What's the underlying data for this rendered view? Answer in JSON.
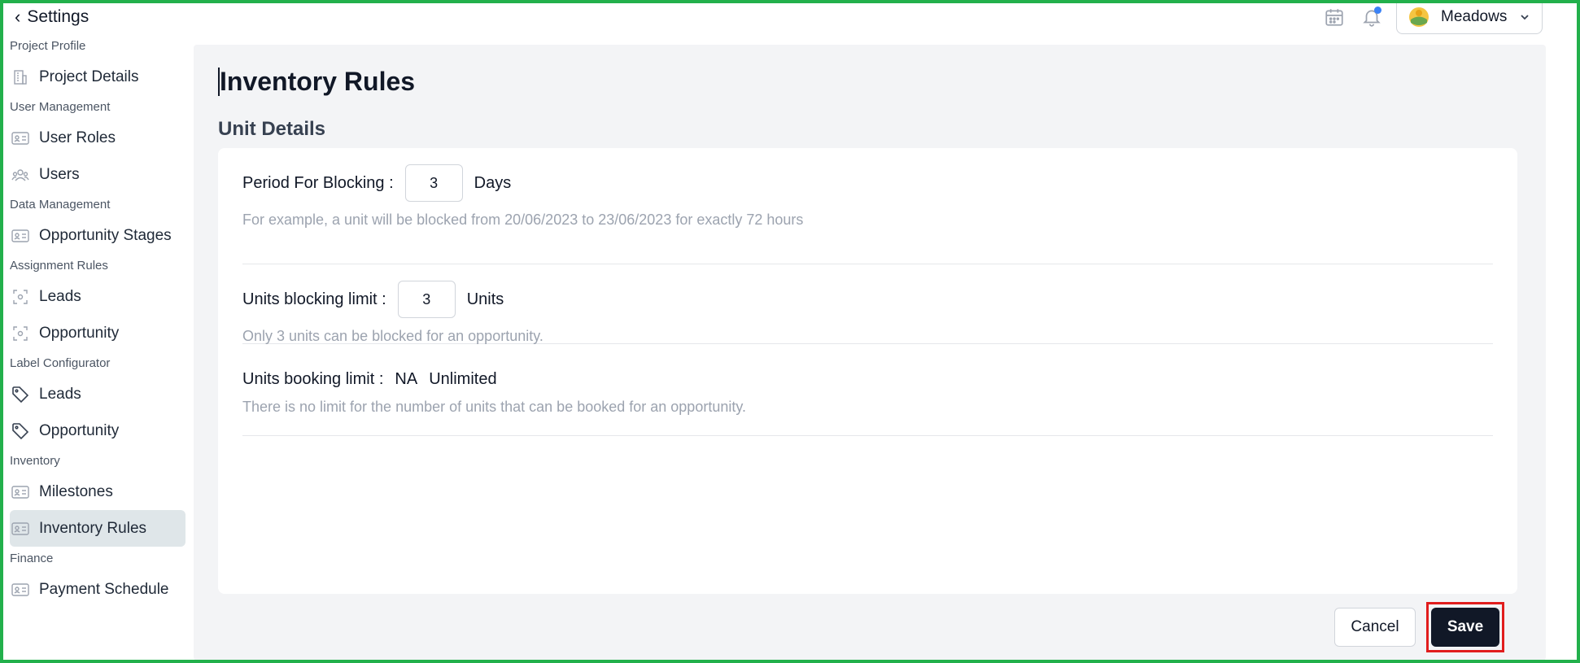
{
  "header": {
    "back_label": "Settings",
    "project_name": "Meadows"
  },
  "sidebar": {
    "groups": [
      {
        "label": "Project Profile",
        "items": [
          {
            "label": "Project Details",
            "icon": "building-icon"
          }
        ]
      },
      {
        "label": "User Management",
        "items": [
          {
            "label": "User Roles",
            "icon": "id-card-icon"
          },
          {
            "label": "Users",
            "icon": "users-icon"
          }
        ]
      },
      {
        "label": "Data Management",
        "items": [
          {
            "label": "Opportunity Stages",
            "icon": "id-card-icon"
          }
        ]
      },
      {
        "label": "Assignment Rules",
        "items": [
          {
            "label": "Leads",
            "icon": "focus-icon"
          },
          {
            "label": "Opportunity",
            "icon": "focus-icon"
          }
        ]
      },
      {
        "label": "Label Configurator",
        "items": [
          {
            "label": "Leads",
            "icon": "tag-icon"
          },
          {
            "label": "Opportunity",
            "icon": "tag-icon"
          }
        ]
      },
      {
        "label": "Inventory",
        "items": [
          {
            "label": "Milestones",
            "icon": "id-card-icon"
          },
          {
            "label": "Inventory Rules",
            "icon": "id-card-icon",
            "active": true
          }
        ]
      },
      {
        "label": "Finance",
        "items": [
          {
            "label": "Payment Schedule",
            "icon": "id-card-icon"
          }
        ]
      }
    ]
  },
  "main": {
    "title": "Inventory Rules",
    "section_title": "Unit Details",
    "blocking_period": {
      "label": "Period For Blocking :",
      "value": "3",
      "unit": "Days",
      "help": "For example, a unit will be blocked from 20/06/2023 to 23/06/2023 for exactly 72 hours"
    },
    "blocking_limit": {
      "label": "Units blocking limit :",
      "value": "3",
      "unit": "Units",
      "help": "Only 3 units can be blocked for an opportunity."
    },
    "booking_limit": {
      "label": "Units booking limit :",
      "value": "NA",
      "unit": "Unlimited",
      "help": "There is no limit for the number of units that can be booked for an opportunity."
    },
    "cancel_label": "Cancel",
    "save_label": "Save"
  },
  "colors": {
    "accent_dark": "#111827",
    "highlight_border": "#e11d1d",
    "frame_border": "#22b04b",
    "notification_dot": "#3b82f6",
    "active_nav_bg": "#dfe6e9"
  }
}
